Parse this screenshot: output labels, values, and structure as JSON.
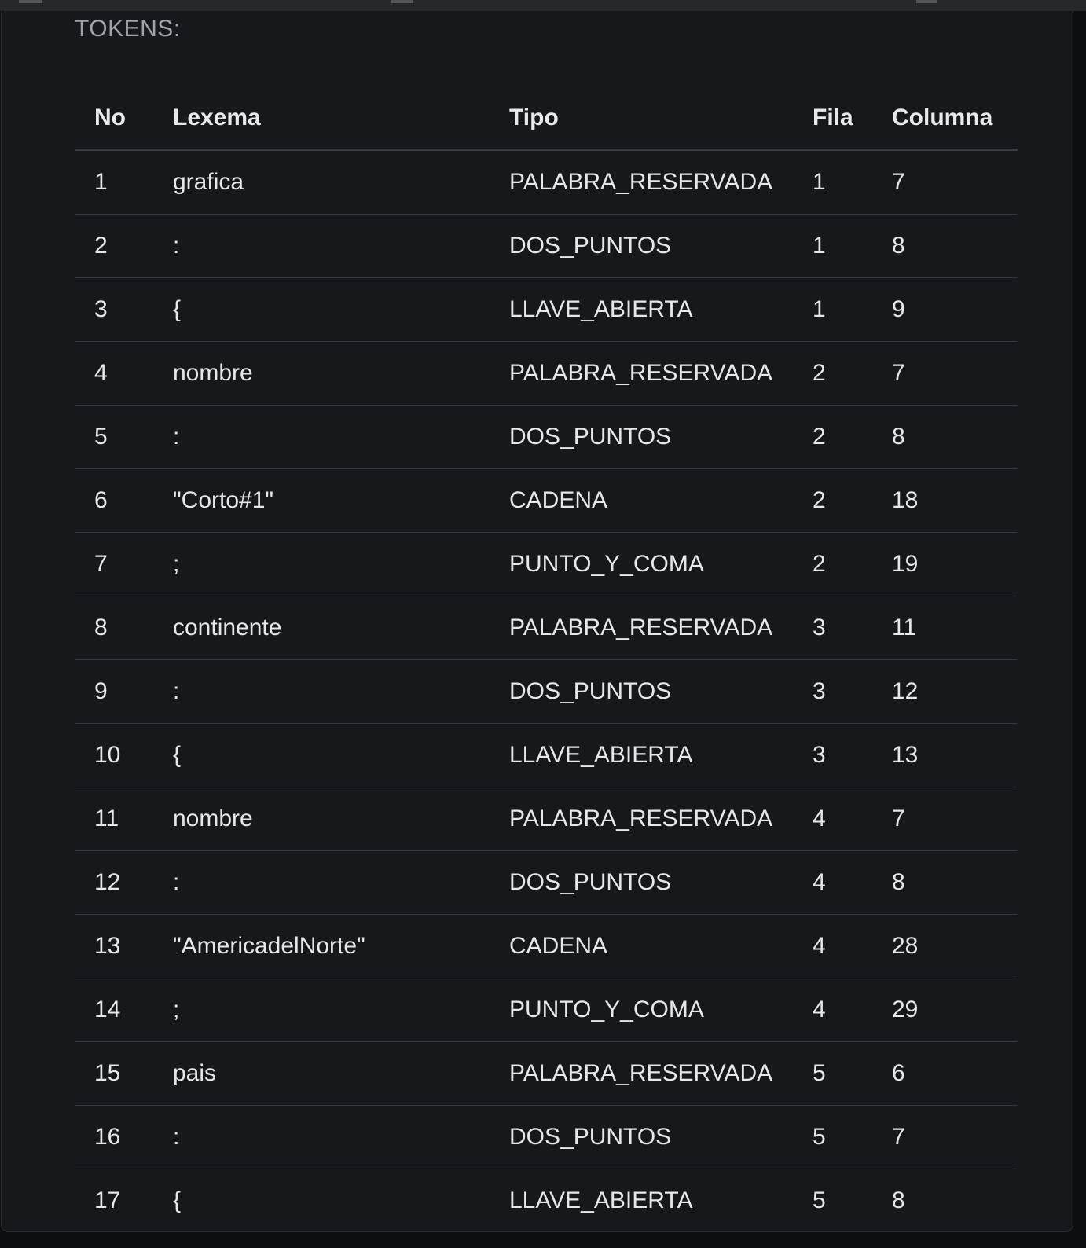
{
  "section": {
    "title": "TOKENS:"
  },
  "table": {
    "headers": {
      "no": "No",
      "lexema": "Lexema",
      "tipo": "Tipo",
      "fila": "Fila",
      "columna": "Columna"
    },
    "rows": [
      {
        "no": "1",
        "lexema": "grafica",
        "tipo": "PALABRA_RESERVADA",
        "fila": "1",
        "columna": "7"
      },
      {
        "no": "2",
        "lexema": ":",
        "tipo": "DOS_PUNTOS",
        "fila": "1",
        "columna": "8"
      },
      {
        "no": "3",
        "lexema": "{",
        "tipo": "LLAVE_ABIERTA",
        "fila": "1",
        "columna": "9"
      },
      {
        "no": "4",
        "lexema": "nombre",
        "tipo": "PALABRA_RESERVADA",
        "fila": "2",
        "columna": "7"
      },
      {
        "no": "5",
        "lexema": ":",
        "tipo": "DOS_PUNTOS",
        "fila": "2",
        "columna": "8"
      },
      {
        "no": "6",
        "lexema": "\"Corto#1\"",
        "tipo": "CADENA",
        "fila": "2",
        "columna": "18"
      },
      {
        "no": "7",
        "lexema": ";",
        "tipo": "PUNTO_Y_COMA",
        "fila": "2",
        "columna": "19"
      },
      {
        "no": "8",
        "lexema": "continente",
        "tipo": "PALABRA_RESERVADA",
        "fila": "3",
        "columna": "11"
      },
      {
        "no": "9",
        "lexema": ":",
        "tipo": "DOS_PUNTOS",
        "fila": "3",
        "columna": "12"
      },
      {
        "no": "10",
        "lexema": "{",
        "tipo": "LLAVE_ABIERTA",
        "fila": "3",
        "columna": "13"
      },
      {
        "no": "11",
        "lexema": "nombre",
        "tipo": "PALABRA_RESERVADA",
        "fila": "4",
        "columna": "7"
      },
      {
        "no": "12",
        "lexema": ":",
        "tipo": "DOS_PUNTOS",
        "fila": "4",
        "columna": "8"
      },
      {
        "no": "13",
        "lexema": "\"AmericadelNorte\"",
        "tipo": "CADENA",
        "fila": "4",
        "columna": "28"
      },
      {
        "no": "14",
        "lexema": ";",
        "tipo": "PUNTO_Y_COMA",
        "fila": "4",
        "columna": "29"
      },
      {
        "no": "15",
        "lexema": "pais",
        "tipo": "PALABRA_RESERVADA",
        "fila": "5",
        "columna": "6"
      },
      {
        "no": "16",
        "lexema": ":",
        "tipo": "DOS_PUNTOS",
        "fila": "5",
        "columna": "7"
      },
      {
        "no": "17",
        "lexema": "{",
        "tipo": "LLAVE_ABIERTA",
        "fila": "5",
        "columna": "8"
      }
    ]
  }
}
